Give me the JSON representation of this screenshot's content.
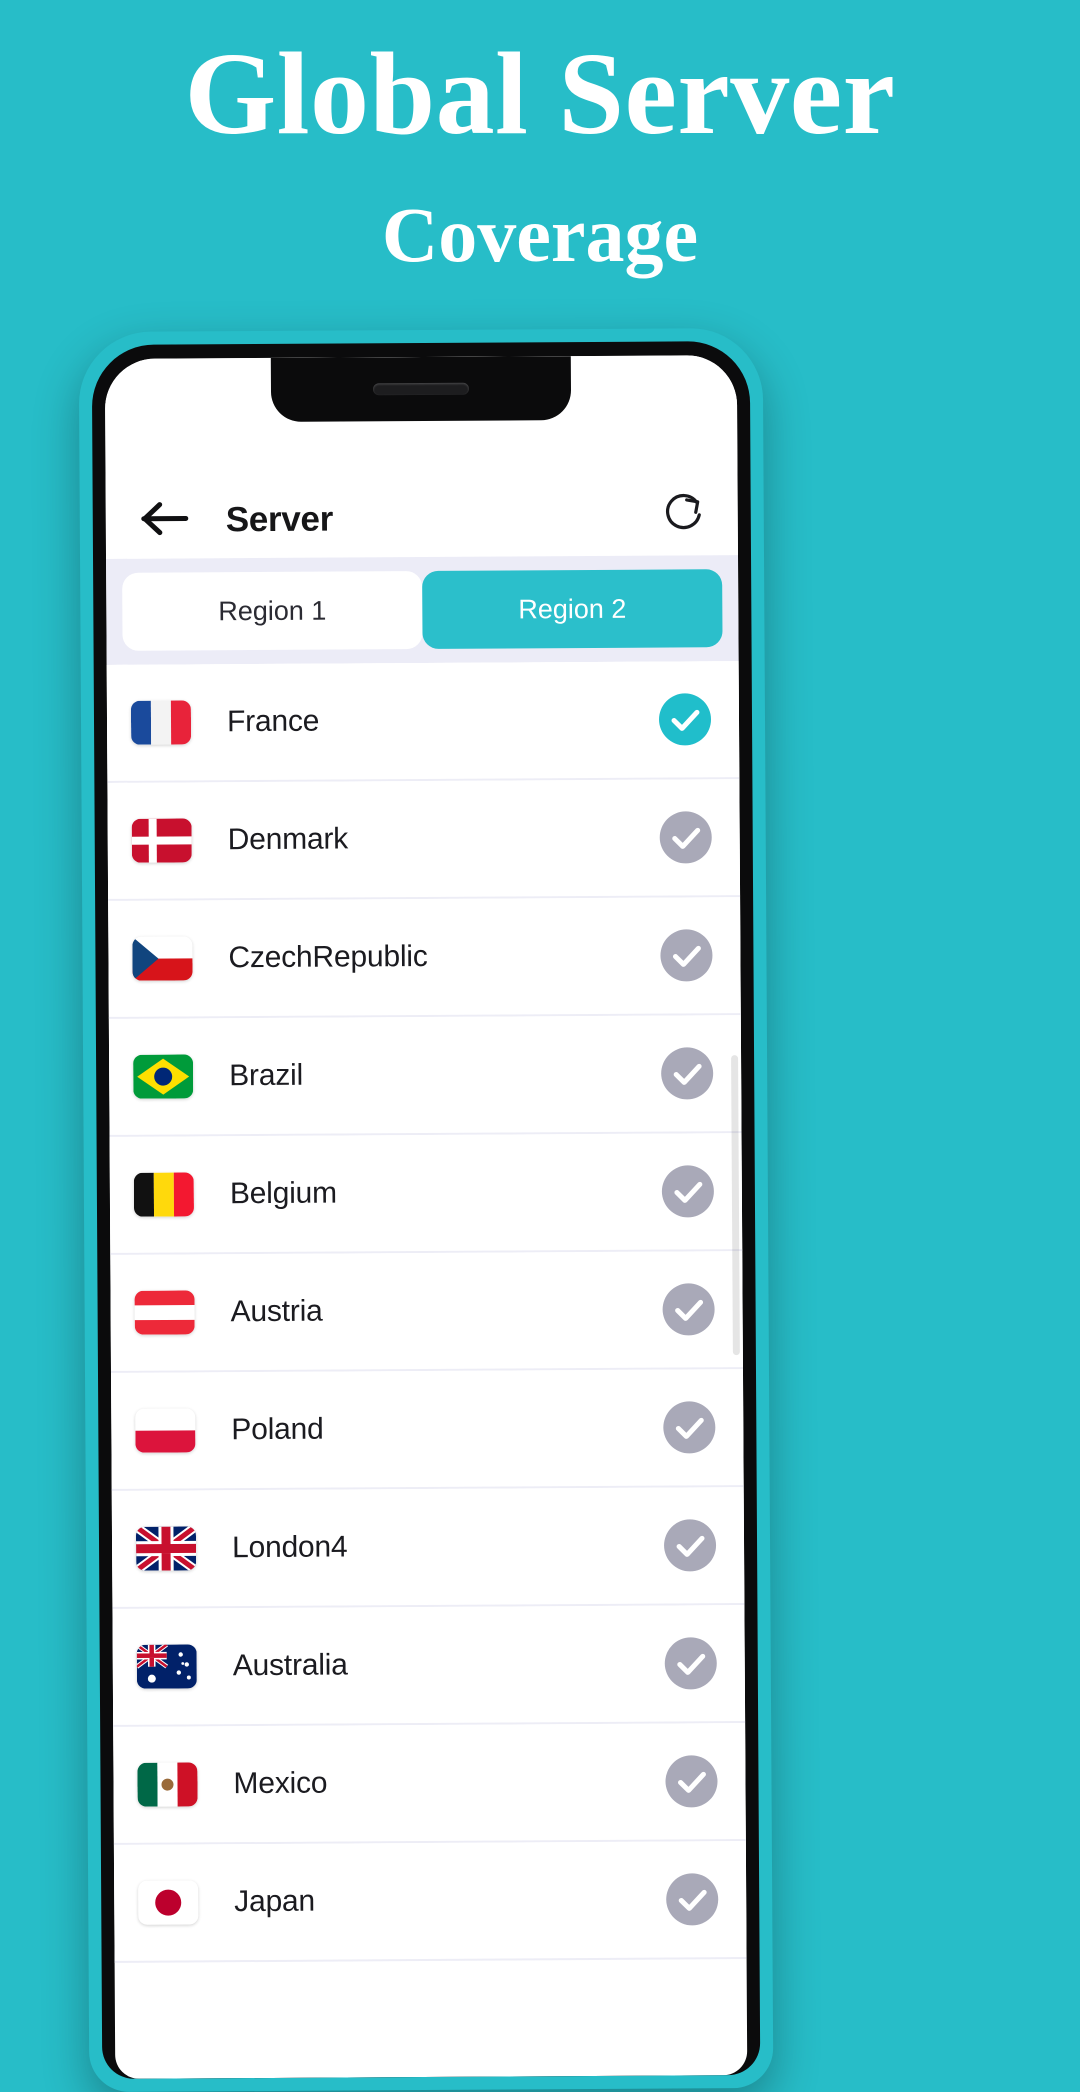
{
  "promo": {
    "title": "Global Server",
    "subtitle": "Coverage",
    "background_color": "#27BDC8",
    "text_color": "#FFFFFF"
  },
  "app": {
    "header": {
      "back_icon": "arrow-left-icon",
      "title": "Server",
      "refresh_icon": "refresh-icon"
    },
    "segmented_control": {
      "items": [
        {
          "label": "Region 1",
          "active": false
        },
        {
          "label": "Region 2",
          "active": true
        }
      ],
      "active_color": "#2BBFCB",
      "track_color": "#ECECF7"
    },
    "servers": [
      {
        "name": "France",
        "flag": "flag-france",
        "selected": true
      },
      {
        "name": "Denmark",
        "flag": "flag-denmark",
        "selected": false
      },
      {
        "name": "CzechRepublic",
        "flag": "flag-czech-republic",
        "selected": false
      },
      {
        "name": "Brazil",
        "flag": "flag-brazil",
        "selected": false
      },
      {
        "name": "Belgium",
        "flag": "flag-belgium",
        "selected": false
      },
      {
        "name": "Austria",
        "flag": "flag-austria",
        "selected": false
      },
      {
        "name": "Poland",
        "flag": "flag-poland",
        "selected": false
      },
      {
        "name": "London4",
        "flag": "flag-united-kingdom",
        "selected": false
      },
      {
        "name": "Australia",
        "flag": "flag-australia",
        "selected": false
      },
      {
        "name": "Mexico",
        "flag": "flag-mexico",
        "selected": false
      },
      {
        "name": "Japan",
        "flag": "flag-japan",
        "selected": false
      }
    ],
    "colors": {
      "accent": "#20BECB",
      "inactive_check": "#A9A9B8",
      "row_divider": "#EDEDF6",
      "screen_bg": "#FFFFFF"
    }
  }
}
